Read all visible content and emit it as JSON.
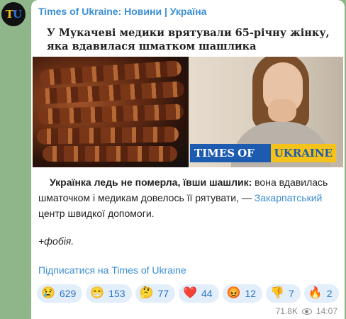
{
  "channel": {
    "avatar_text_t": "T",
    "avatar_text_u": "U",
    "name": "Times of Ukraine: Новини | Україна"
  },
  "post": {
    "headline": "У Мукачеві медики врятували 65-річну жінку, яка вдавилася шматком шашлика",
    "image_logo": {
      "times": "TIMES",
      "of": "OF",
      "ukraine": "UKRAINE"
    },
    "lead_bold": "Українка ледь не померла, ївши шашлик:",
    "body_text": " вона вдавилась шматочком і медикам довелось її рятувати, — ",
    "body_link": "Закарпатський",
    "body_tail": " центр швидкої допомоги.",
    "phobia": "+фобія.",
    "subscribe_link": "Підписатися на Times of Ukraine"
  },
  "reactions": [
    {
      "emoji": "😢",
      "count": "629"
    },
    {
      "emoji": "😁",
      "count": "153"
    },
    {
      "emoji": "🤔",
      "count": "77"
    },
    {
      "emoji": "❤️",
      "count": "44"
    },
    {
      "emoji": "😡",
      "count": "12"
    },
    {
      "emoji": "👎",
      "count": "7"
    },
    {
      "emoji": "🔥",
      "count": "2"
    }
  ],
  "meta": {
    "views": "71.8K",
    "time": "14:07"
  },
  "colors": {
    "background": "#8fb58a",
    "link": "#3a8ed3",
    "reaction_bg": "#e3eefb",
    "brand_blue": "#1d5bb0",
    "brand_yellow": "#f4c21a"
  }
}
